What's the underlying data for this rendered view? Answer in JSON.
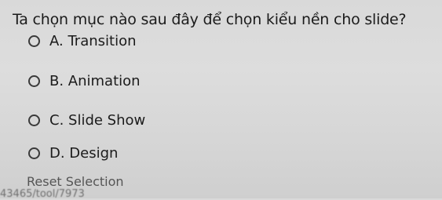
{
  "question": {
    "text": "Ta chọn mục nào sau đây để chọn kiểu nền cho slide?"
  },
  "options": [
    {
      "label": "A. Transition"
    },
    {
      "label": "B. Animation"
    },
    {
      "label": "C. Slide Show"
    },
    {
      "label": "D. Design"
    }
  ],
  "reset_label": "Reset Selection",
  "footer_text": "43465/tool/7973"
}
